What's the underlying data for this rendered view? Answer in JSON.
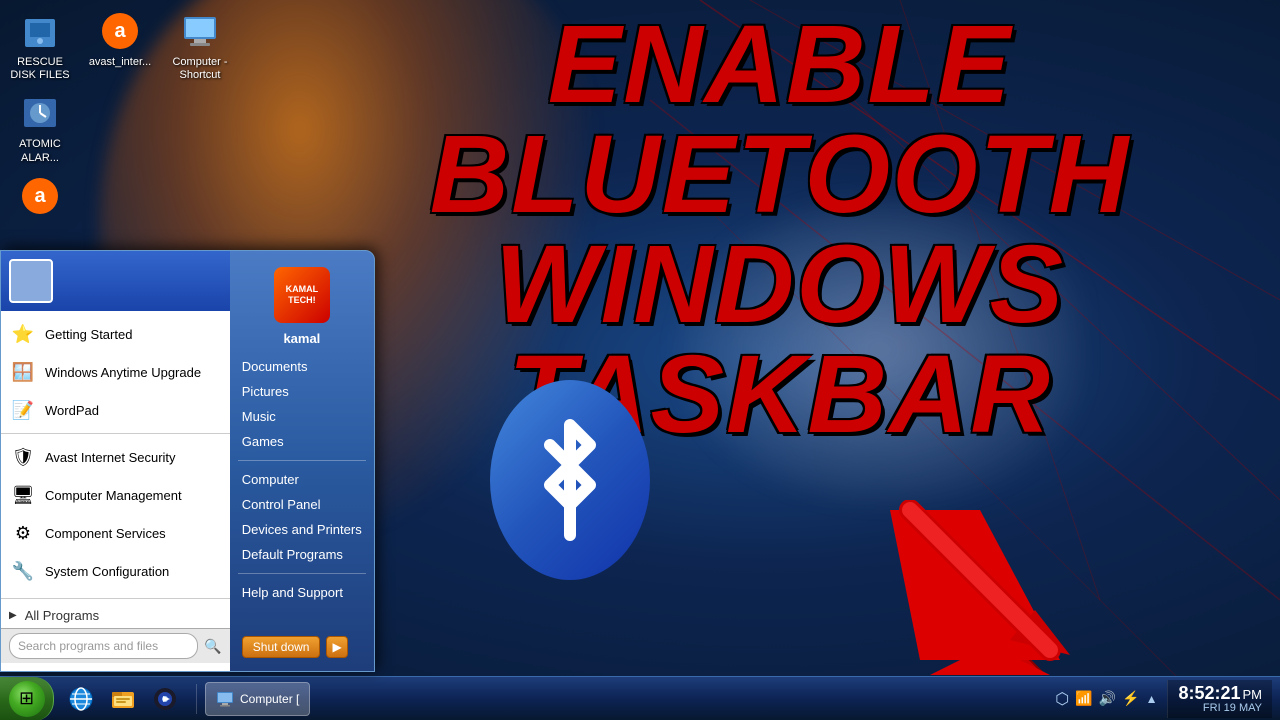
{
  "desktop": {
    "background_colors": [
      "#1a3a6b",
      "#0d2550",
      "#071830"
    ]
  },
  "overlay_title": {
    "line1": "ENABLE BLUETOOTH",
    "line2": "WINDOWS",
    "line3": "TASKBAR"
  },
  "desktop_icons": [
    {
      "id": "rescue-disk",
      "label": "RESCUE DISK\nFILES",
      "icon": "💾"
    },
    {
      "id": "avast-internet",
      "label": "avast_inter...",
      "icon": "🛡"
    },
    {
      "id": "computer-shortcut",
      "label": "Computer -\nShortcut",
      "icon": "💻"
    },
    {
      "id": "atomic-alarm",
      "label": "ATOMIC\nALAR...",
      "icon": "⏰"
    },
    {
      "id": "avast2",
      "label": "",
      "icon": "🛡"
    }
  ],
  "start_menu": {
    "visible": true,
    "left_items": [
      {
        "id": "getting-started",
        "label": "Getting Started",
        "icon": "⭐"
      },
      {
        "id": "windows-anytime",
        "label": "Windows Anytime Upgrade",
        "icon": "🪟"
      },
      {
        "id": "wordpad",
        "label": "WordPad",
        "icon": "📝"
      },
      {
        "id": "avast",
        "label": "Avast Internet Security",
        "icon": "🛡"
      },
      {
        "id": "computer-mgmt",
        "label": "Computer Management",
        "icon": "🖥"
      },
      {
        "id": "component-services",
        "label": "Component Services",
        "icon": "⚙"
      },
      {
        "id": "system-config",
        "label": "System Configuration",
        "icon": "🔧"
      }
    ],
    "all_programs_label": "All Programs",
    "search_placeholder": "Search programs and files",
    "right_items": [
      {
        "id": "kamal",
        "label": "kamal"
      },
      {
        "id": "documents",
        "label": "Documents"
      },
      {
        "id": "pictures",
        "label": "Pictures"
      },
      {
        "id": "music",
        "label": "Music"
      },
      {
        "id": "games",
        "label": "Games"
      },
      {
        "id": "computer",
        "label": "Computer"
      },
      {
        "id": "control-panel",
        "label": "Control Panel"
      },
      {
        "id": "devices-printers",
        "label": "Devices and Printers"
      },
      {
        "id": "default-programs",
        "label": "Default Programs"
      },
      {
        "id": "help-support",
        "label": "Help and Support"
      }
    ],
    "user_logo_text": "KAMAL\nTECH!",
    "shutdown_label": "Shut down"
  },
  "taskbar": {
    "pinned_apps": [
      {
        "id": "ie",
        "icon": "🌐",
        "label": "Internet Explorer"
      },
      {
        "id": "explorer",
        "icon": "📁",
        "label": "Windows Explorer"
      },
      {
        "id": "media-player",
        "icon": "🎵",
        "label": "Windows Media Player"
      }
    ],
    "active_apps": [
      {
        "id": "active-app",
        "label": "Computer [",
        "icon": "💻"
      }
    ],
    "tray_icons": [
      {
        "id": "bluetooth-tray",
        "icon": "⬡"
      },
      {
        "id": "network",
        "icon": "📶"
      },
      {
        "id": "volume",
        "icon": "🔊"
      },
      {
        "id": "battery",
        "icon": "🔋"
      }
    ],
    "clock": {
      "time": "8:52:21",
      "ampm": "PM",
      "date": "FRI 19\nMAY"
    },
    "start_label": "Start"
  }
}
